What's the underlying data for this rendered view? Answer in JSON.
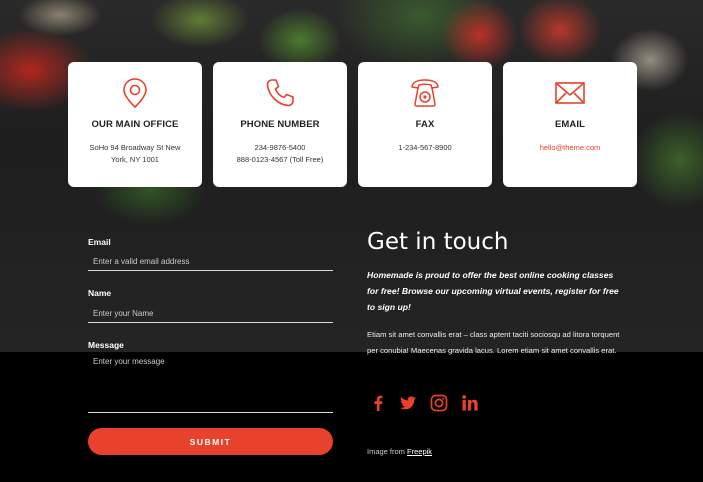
{
  "cards": [
    {
      "icon": "map-pin-icon",
      "title": "OUR MAIN OFFICE",
      "lines": [
        "SoHo 94 Broadway St New",
        "York, NY 1001"
      ]
    },
    {
      "icon": "phone-icon",
      "title": "PHONE NUMBER",
      "lines": [
        "234-9876-5400",
        "888-0123-4567 (Toll Free)"
      ]
    },
    {
      "icon": "fax-icon",
      "title": "FAX",
      "lines": [
        "1-234-567-8900"
      ]
    },
    {
      "icon": "envelope-icon",
      "title": "EMAIL",
      "lines": [
        "hello@theme.com"
      ]
    }
  ],
  "form": {
    "email_label": "Email",
    "email_placeholder": "Enter a valid email address",
    "name_label": "Name",
    "name_placeholder": "Enter your Name",
    "message_label": "Message",
    "message_placeholder": "Enter your message",
    "submit_label": "SUBMIT"
  },
  "contact": {
    "heading": "Get in touch",
    "lead": "Homemade is proud to offer the best online cooking classes for free! Browse our upcoming virtual events, register for free to sign up!",
    "body": "Etiam sit amet convallis erat – class aptent taciti sociosqu ad litora torquent per conubia! Maecenas gravida lacus. Lorem etiam sit amet convallis erat.",
    "social": [
      "facebook-icon",
      "twitter-icon",
      "instagram-icon",
      "linkedin-icon"
    ],
    "credit_prefix": "Image from",
    "credit_link": "Freepik"
  },
  "colors": {
    "accent": "#e8412c",
    "card_bg": "#ffffff",
    "footer_bg": "#000000"
  }
}
